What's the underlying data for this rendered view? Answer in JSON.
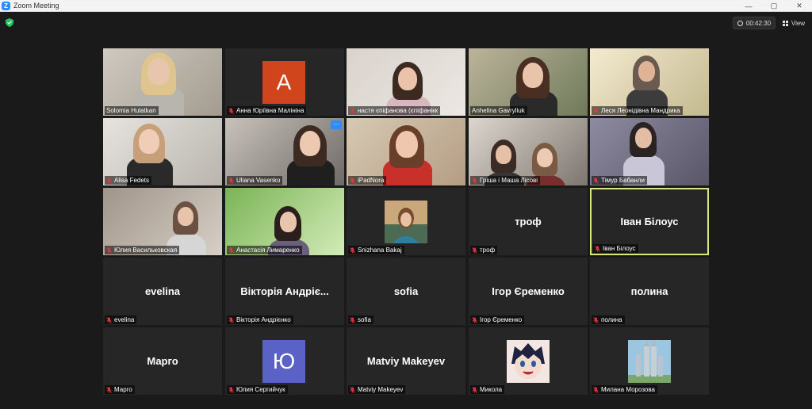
{
  "window": {
    "title": "Zoom Meeting",
    "minimize": "—",
    "maximize": "▢",
    "close": "✕"
  },
  "toolbar": {
    "timer": "00:42:30",
    "view_label": "View"
  },
  "tiles": [
    {
      "name": "Solomia Hulatkan",
      "muted": false,
      "type": "video"
    },
    {
      "name": "Анна Юріївна Малініна",
      "muted": true,
      "type": "avatar",
      "avatar_letter": "A",
      "avatar_color": "#d0451b"
    },
    {
      "name": "настя єпіфанова (єпіфанікк",
      "muted": true,
      "type": "video"
    },
    {
      "name": "Anhelina Gavryliuk",
      "muted": false,
      "type": "video"
    },
    {
      "name": "Леся Леонідівна Мандрика",
      "muted": true,
      "type": "video"
    },
    {
      "name": "Alisa Fedets",
      "muted": true,
      "type": "video"
    },
    {
      "name": "Uliana Vasenko",
      "muted": true,
      "type": "video",
      "more_button": "···"
    },
    {
      "name": "iPadNora",
      "muted": true,
      "type": "video"
    },
    {
      "name": "Гріша і Маша Лісові",
      "muted": true,
      "type": "video"
    },
    {
      "name": "Тімур Бабанли",
      "muted": true,
      "type": "video"
    },
    {
      "name": "Юлия Васильковская",
      "muted": true,
      "type": "video"
    },
    {
      "name": "Анастасія Лимаренко",
      "muted": true,
      "type": "video"
    },
    {
      "name": "Snizhana Bakaj",
      "muted": true,
      "type": "picture"
    },
    {
      "name": "троф",
      "muted": true,
      "type": "name",
      "big_name": "троф"
    },
    {
      "name": "Іван Білоус",
      "muted": true,
      "type": "name",
      "big_name": "Іван Білоус",
      "active_speaker": true
    },
    {
      "name": "evelina",
      "muted": true,
      "type": "name",
      "big_name": "evelina"
    },
    {
      "name": "Вікторія Андрієнко",
      "muted": true,
      "type": "name",
      "big_name": "Вікторія Андріє..."
    },
    {
      "name": "sofia",
      "muted": true,
      "type": "name",
      "big_name": "sofia"
    },
    {
      "name": "Ігор Єременко",
      "muted": true,
      "type": "name",
      "big_name": "Ігор Єременко"
    },
    {
      "name": "полина",
      "muted": true,
      "type": "name",
      "big_name": "полина"
    },
    {
      "name": "Марго",
      "muted": true,
      "type": "name",
      "big_name": "Марго"
    },
    {
      "name": "Юлия Сергийчук",
      "muted": true,
      "type": "avatar",
      "avatar_letter": "Ю",
      "avatar_color": "#5b62c6"
    },
    {
      "name": "Matviy Makeyev",
      "muted": true,
      "type": "name",
      "big_name": "Matviy Makeyev"
    },
    {
      "name": "Микола",
      "muted": true,
      "type": "picture"
    },
    {
      "name": "Милана Морозова",
      "muted": true,
      "type": "picture"
    }
  ],
  "colors": {
    "active_speaker_border": "#d8e67a",
    "tile_bg": "#262626",
    "app_bg": "#1a1a1a",
    "mute_icon": "#e0383e",
    "security_shield": "#21c25e"
  }
}
